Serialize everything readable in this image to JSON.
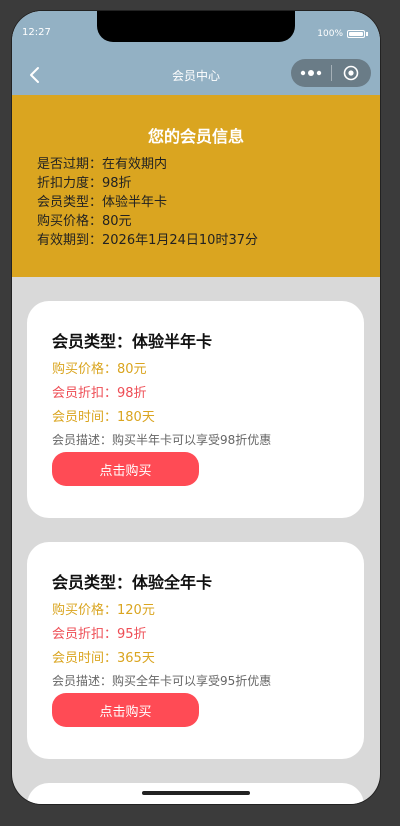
{
  "status_bar": {
    "time": "12:27",
    "battery_percent": "100%"
  },
  "nav": {
    "title": "会员中心"
  },
  "member_info": {
    "title": "您的会员信息",
    "lines": [
      "是否过期：在有效期内",
      "折扣力度：98折",
      "会员类型：体验半年卡",
      "购买价格：80元",
      "有效期到：2026年1月24日10时37分"
    ]
  },
  "cards": [
    {
      "title": "会员类型：体验半年卡",
      "price": "购买价格：80元",
      "discount": "会员折扣：98折",
      "time": "会员时间：180天",
      "desc": "会员描述：购买半年卡可以享受98折优惠",
      "button": "点击购买"
    },
    {
      "title": "会员类型：体验全年卡",
      "price": "购买价格：120元",
      "discount": "会员折扣：95折",
      "time": "会员时间：365天",
      "desc": "会员描述：购买全年卡可以享受95折优惠",
      "button": "点击购买"
    }
  ],
  "colors": {
    "header": "#93b1c4",
    "info_panel": "#daa520",
    "price_text": "#daa520",
    "discount_text": "#ee4d55",
    "button": "#ff4b55"
  },
  "icons": {
    "back": "chevron-left-icon",
    "more": "more-dots-icon",
    "close": "target-circle-icon",
    "battery": "battery-icon"
  }
}
